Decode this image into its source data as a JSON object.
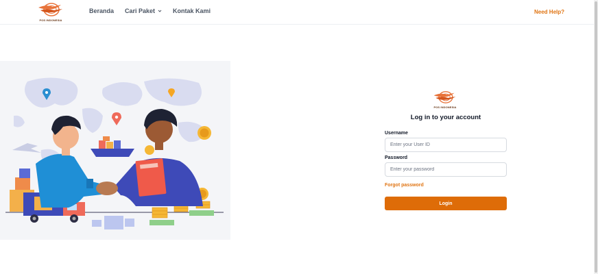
{
  "brand": {
    "logo_text": "POS INDONESIA"
  },
  "nav": {
    "home": "Beranda",
    "track": "Cari Paket",
    "contact": "Kontak Kami"
  },
  "help": "Need Help?",
  "login": {
    "title": "Log in to your account",
    "username_label": "Username",
    "username_placeholder": "Enter your User ID",
    "password_label": "Password",
    "password_placeholder": "Enter your password",
    "forgot": "Forgot password",
    "submit": "Login"
  },
  "colors": {
    "accent": "#de6c08",
    "link": "#e07412"
  }
}
